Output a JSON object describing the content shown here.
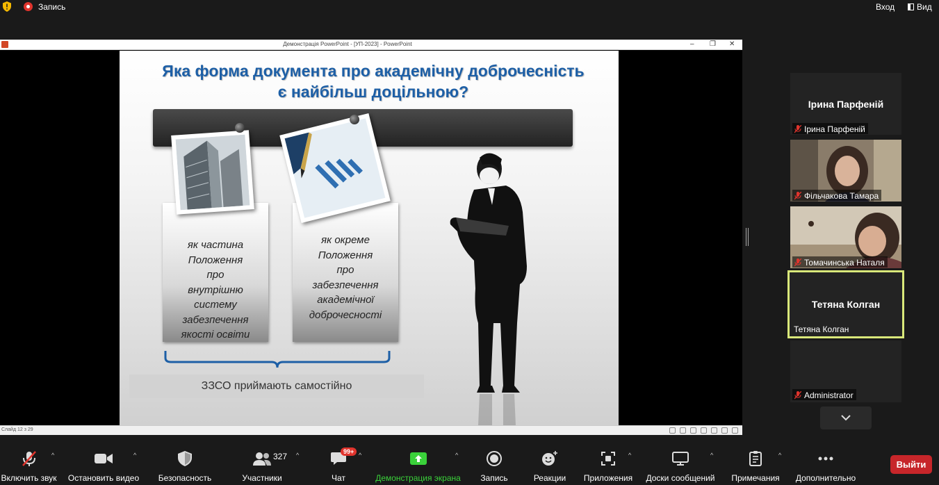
{
  "topbar": {
    "record_label": "Запись",
    "enter_label": "Вход",
    "view_label": "Вид"
  },
  "ppt": {
    "window_title": "Демонстрація PowerPoint - [УП-2023] - PowerPoint",
    "slide_status": "Слайд 12 з 29",
    "slide": {
      "title_line1": "Яка форма документа про  академічну доброчесність",
      "title_line2": "є найбільш доцільною?",
      "card1_lines": [
        "як частина",
        "Положення",
        "про",
        "внутрішню",
        "систему",
        "забезпечення",
        "якості освіти"
      ],
      "card2_lines": [
        "як окреме",
        "Положення",
        "про",
        "забезпечення",
        "академічної",
        "доброчесності"
      ],
      "caption": "ЗЗСО приймають самостійно"
    }
  },
  "participants": [
    {
      "name": "Ірина Парфеній",
      "label": "Ірина Парфеній",
      "muted": true,
      "video": false
    },
    {
      "name": "Фільчакова Тамара",
      "label": "Фільчакова Тамара",
      "muted": true,
      "video": true
    },
    {
      "name": "Томачинська Наталя",
      "label": "Томачинська Наталя",
      "muted": true,
      "video": true
    },
    {
      "name": "Тетяна Колган",
      "label": "Тетяна Колган",
      "muted": false,
      "video": false,
      "active": true
    },
    {
      "name": "Administrator",
      "label": "Administrator",
      "muted": true,
      "video": false
    }
  ],
  "toolbar": {
    "unmute": "Включить звук",
    "stop_video": "Остановить видео",
    "security": "Безопасность",
    "participants": "Участники",
    "participants_count": "327",
    "chat": "Чат",
    "chat_badge": "99+",
    "share": "Демонстрация экрана",
    "record": "Запись",
    "reactions": "Реакции",
    "apps": "Приложения",
    "whiteboards": "Доски сообщений",
    "notes": "Примечания",
    "more": "Дополнительно",
    "exit": "Выйти"
  },
  "colors": {
    "accent_green": "#3ad13a",
    "exit_red": "#c7262a",
    "active_border": "#d9e87a",
    "title_blue": "#1d5fa6"
  }
}
